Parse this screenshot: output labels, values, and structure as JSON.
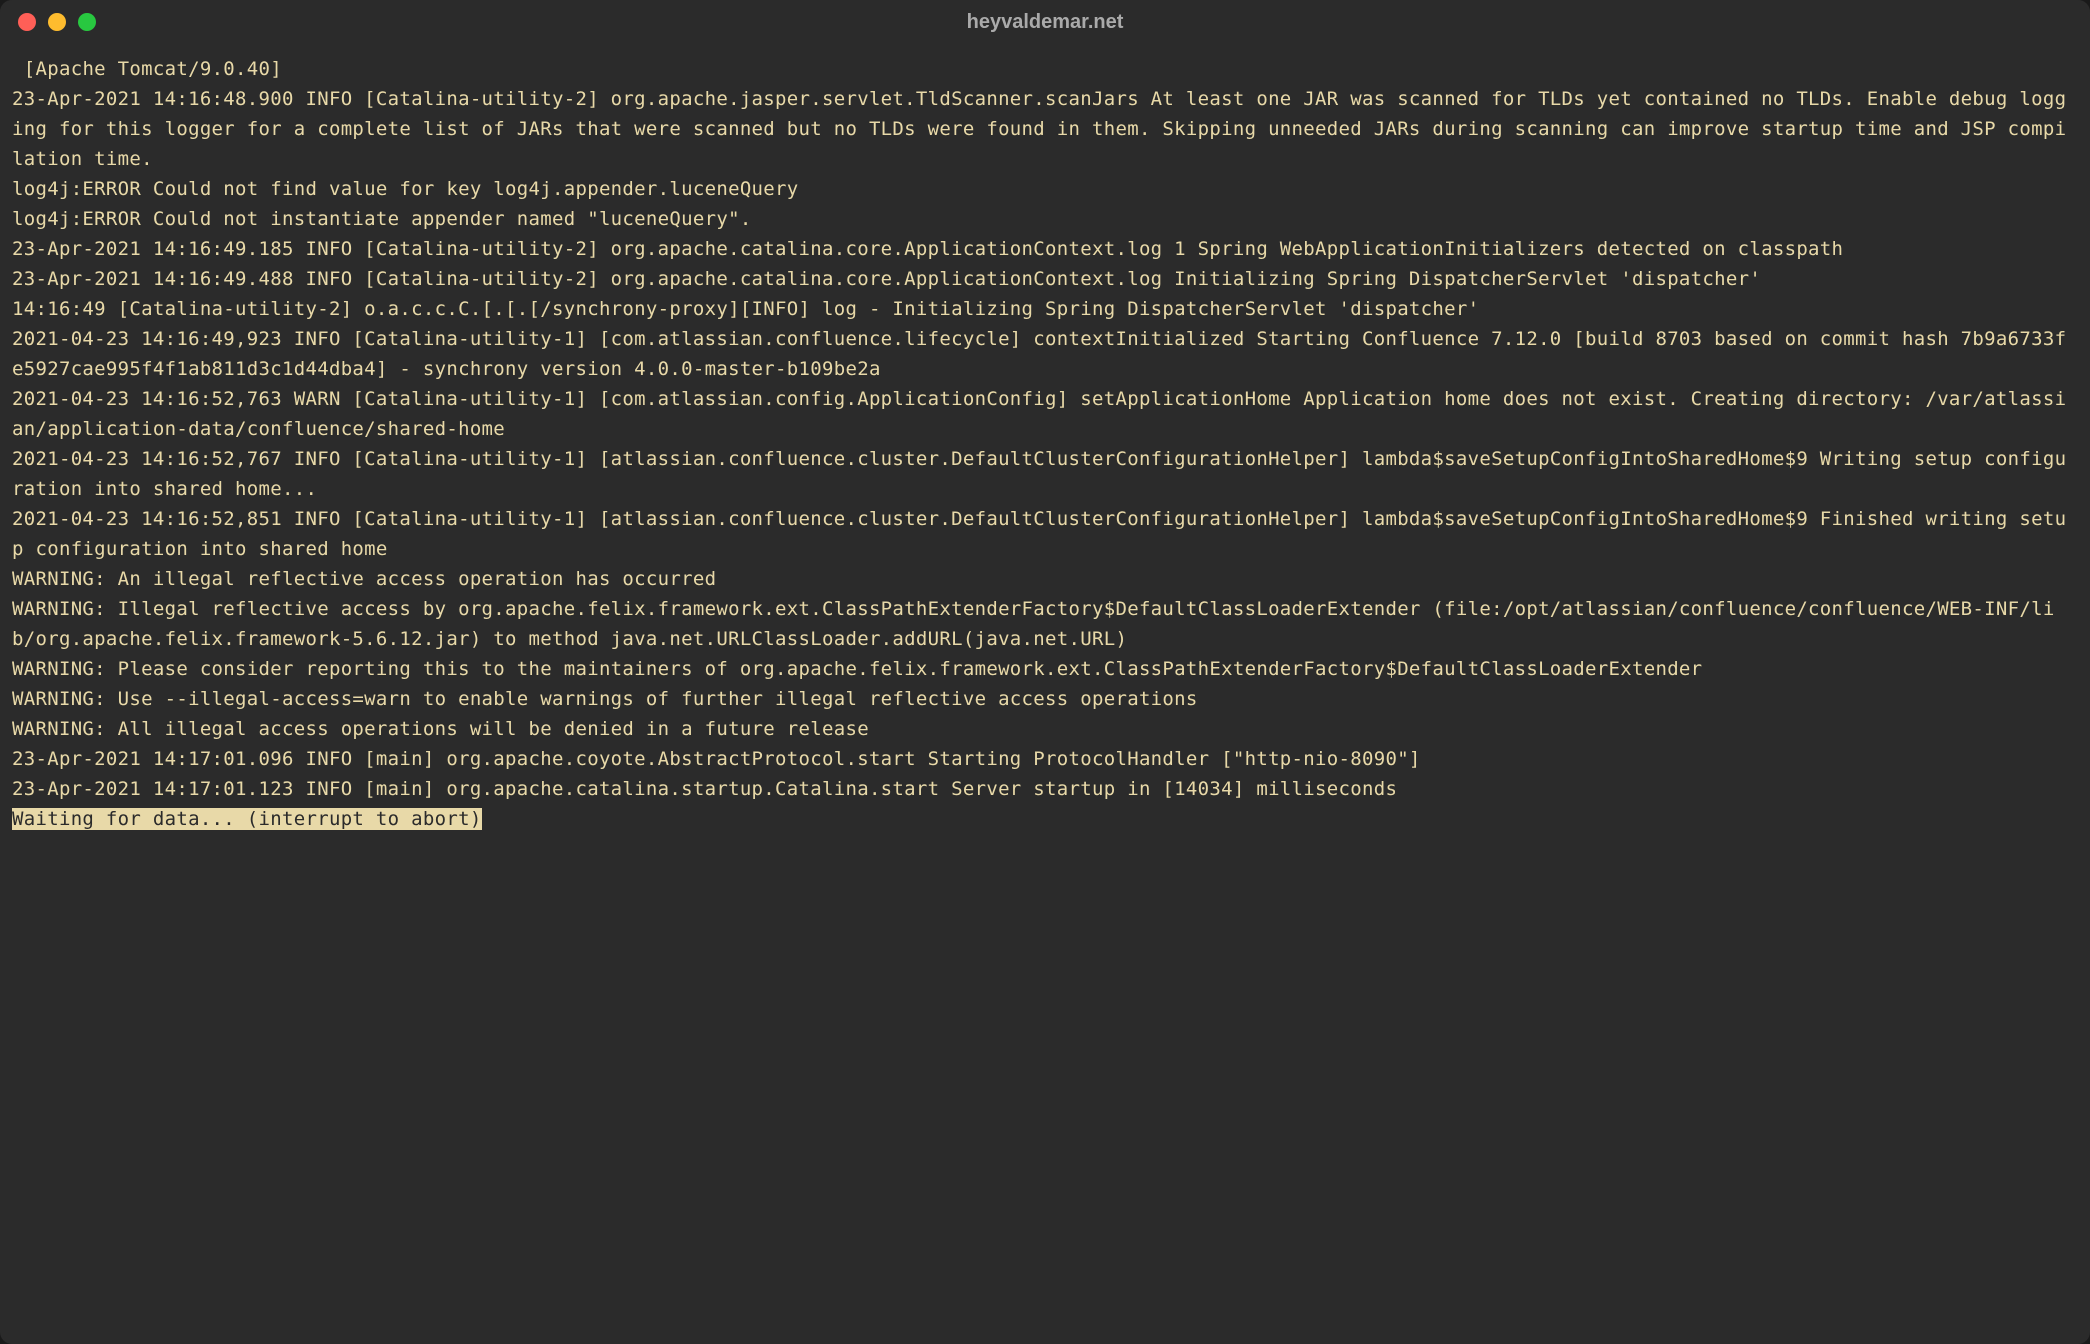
{
  "window": {
    "title": "heyvaldemar.net"
  },
  "terminal": {
    "lines": [
      " [Apache Tomcat/9.0.40]",
      "23-Apr-2021 14:16:48.900 INFO [Catalina-utility-2] org.apache.jasper.servlet.TldScanner.scanJars At least one JAR was scanned for TLDs yet contained no TLDs. Enable debug logging for this logger for a complete list of JARs that were scanned but no TLDs were found in them. Skipping unneeded JARs during scanning can improve startup time and JSP compilation time.",
      "log4j:ERROR Could not find value for key log4j.appender.luceneQuery",
      "log4j:ERROR Could not instantiate appender named \"luceneQuery\".",
      "23-Apr-2021 14:16:49.185 INFO [Catalina-utility-2] org.apache.catalina.core.ApplicationContext.log 1 Spring WebApplicationInitializers detected on classpath",
      "23-Apr-2021 14:16:49.488 INFO [Catalina-utility-2] org.apache.catalina.core.ApplicationContext.log Initializing Spring DispatcherServlet 'dispatcher'",
      "14:16:49 [Catalina-utility-2] o.a.c.c.C.[.[.[/synchrony-proxy][INFO] log - Initializing Spring DispatcherServlet 'dispatcher'",
      "2021-04-23 14:16:49,923 INFO [Catalina-utility-1] [com.atlassian.confluence.lifecycle] contextInitialized Starting Confluence 7.12.0 [build 8703 based on commit hash 7b9a6733fe5927cae995f4f1ab811d3c1d44dba4] - synchrony version 4.0.0-master-b109be2a",
      "2021-04-23 14:16:52,763 WARN [Catalina-utility-1] [com.atlassian.config.ApplicationConfig] setApplicationHome Application home does not exist. Creating directory: /var/atlassian/application-data/confluence/shared-home",
      "2021-04-23 14:16:52,767 INFO [Catalina-utility-1] [atlassian.confluence.cluster.DefaultClusterConfigurationHelper] lambda$saveSetupConfigIntoSharedHome$9 Writing setup configuration into shared home...",
      "2021-04-23 14:16:52,851 INFO [Catalina-utility-1] [atlassian.confluence.cluster.DefaultClusterConfigurationHelper] lambda$saveSetupConfigIntoSharedHome$9 Finished writing setup configuration into shared home",
      "WARNING: An illegal reflective access operation has occurred",
      "WARNING: Illegal reflective access by org.apache.felix.framework.ext.ClassPathExtenderFactory$DefaultClassLoaderExtender (file:/opt/atlassian/confluence/confluence/WEB-INF/lib/org.apache.felix.framework-5.6.12.jar) to method java.net.URLClassLoader.addURL(java.net.URL)",
      "WARNING: Please consider reporting this to the maintainers of org.apache.felix.framework.ext.ClassPathExtenderFactory$DefaultClassLoaderExtender",
      "WARNING: Use --illegal-access=warn to enable warnings of further illegal reflective access operations",
      "WARNING: All illegal access operations will be denied in a future release",
      "23-Apr-2021 14:17:01.096 INFO [main] org.apache.coyote.AbstractProtocol.start Starting ProtocolHandler [\"http-nio-8090\"]",
      "23-Apr-2021 14:17:01.123 INFO [main] org.apache.catalina.startup.Catalina.start Server startup in [14034] milliseconds"
    ],
    "status_line": "Waiting for data... (interrupt to abort)"
  }
}
